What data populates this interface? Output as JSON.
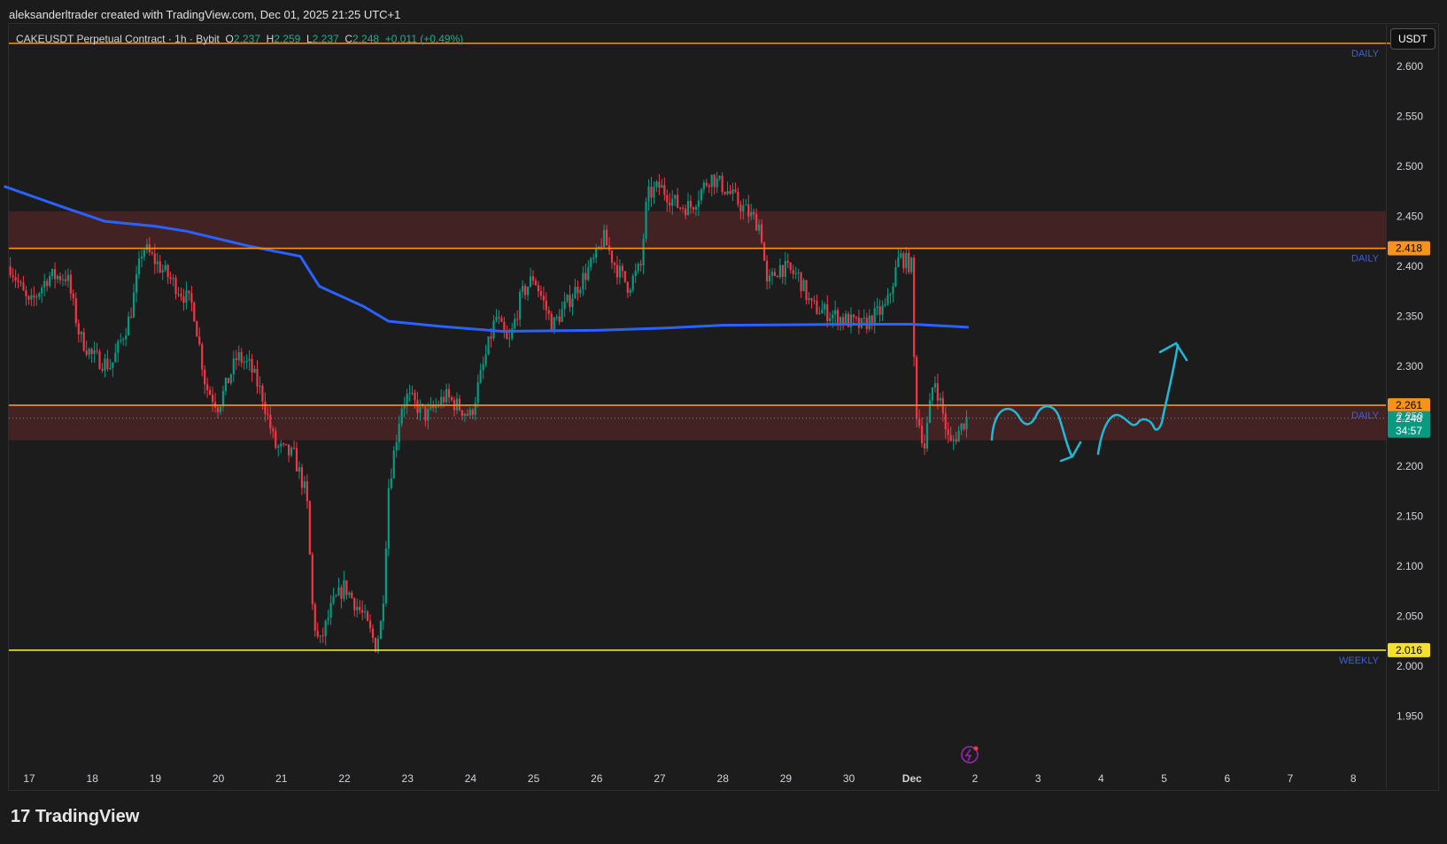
{
  "credit": "aleksanderltrader created with TradingView.com, Dec 01, 2025 21:25 UTC+1",
  "legend": {
    "symbol": "CAKEUSDT Perpetual Contract · 1h · Bybit",
    "o_label": "O",
    "o": "2.237",
    "h_label": "H",
    "h": "2.259",
    "l_label": "L",
    "l": "2.237",
    "c_label": "C",
    "c": "2.248",
    "change": "+0.011 (+0.49%)"
  },
  "currency_button": "USDT",
  "logo": "TradingView",
  "colors": {
    "up": "#089981",
    "down": "#f23645",
    "level": "#f7931a",
    "weekly": "#f5e02a",
    "ema": "#2962ff",
    "zone": "#4a2326",
    "drawing": "#1ebad6"
  },
  "chart_data": {
    "type": "candlestick",
    "ylim": [
      1.9,
      2.63
    ],
    "y_ticks": [
      "2.600",
      "2.550",
      "2.500",
      "2.450",
      "2.400",
      "2.350",
      "2.300",
      "2.250",
      "2.200",
      "2.150",
      "2.100",
      "2.050",
      "2.000",
      "1.950"
    ],
    "x_ticks": [
      "17",
      "18",
      "19",
      "20",
      "21",
      "22",
      "23",
      "24",
      "25",
      "26",
      "27",
      "28",
      "29",
      "30",
      "Dec",
      "2",
      "3",
      "4",
      "5",
      "6",
      "7",
      "8"
    ],
    "price_path": [
      [
        16.7,
        2.4
      ],
      [
        17.0,
        2.36
      ],
      [
        17.3,
        2.39
      ],
      [
        17.6,
        2.39
      ],
      [
        17.8,
        2.33
      ],
      [
        18.0,
        2.31
      ],
      [
        18.3,
        2.3
      ],
      [
        18.6,
        2.35
      ],
      [
        18.8,
        2.42
      ],
      [
        19.2,
        2.39
      ],
      [
        19.6,
        2.36
      ],
      [
        19.8,
        2.28
      ],
      [
        20.0,
        2.26
      ],
      [
        20.3,
        2.31
      ],
      [
        20.5,
        2.3
      ],
      [
        20.7,
        2.27
      ],
      [
        20.9,
        2.22
      ],
      [
        21.2,
        2.21
      ],
      [
        21.4,
        2.17
      ],
      [
        21.5,
        2.05
      ],
      [
        21.6,
        2.02
      ],
      [
        21.8,
        2.06
      ],
      [
        22.0,
        2.08
      ],
      [
        22.3,
        2.05
      ],
      [
        22.5,
        2.02
      ],
      [
        22.6,
        2.05
      ],
      [
        22.7,
        2.18
      ],
      [
        22.9,
        2.26
      ],
      [
        23.0,
        2.27
      ],
      [
        23.3,
        2.25
      ],
      [
        23.6,
        2.27
      ],
      [
        24.0,
        2.25
      ],
      [
        24.2,
        2.3
      ],
      [
        24.4,
        2.35
      ],
      [
        24.6,
        2.32
      ],
      [
        24.8,
        2.37
      ],
      [
        25.0,
        2.39
      ],
      [
        25.3,
        2.34
      ],
      [
        25.5,
        2.36
      ],
      [
        25.7,
        2.38
      ],
      [
        26.0,
        2.41
      ],
      [
        26.1,
        2.43
      ],
      [
        26.3,
        2.4
      ],
      [
        26.5,
        2.38
      ],
      [
        26.7,
        2.4
      ],
      [
        26.8,
        2.47
      ],
      [
        27.0,
        2.48
      ],
      [
        27.3,
        2.46
      ],
      [
        27.5,
        2.46
      ],
      [
        27.8,
        2.49
      ],
      [
        28.0,
        2.48
      ],
      [
        28.3,
        2.46
      ],
      [
        28.6,
        2.44
      ],
      [
        28.7,
        2.38
      ],
      [
        28.9,
        2.4
      ],
      [
        29.2,
        2.39
      ],
      [
        29.4,
        2.36
      ],
      [
        29.8,
        2.35
      ],
      [
        30.2,
        2.34
      ],
      [
        30.6,
        2.36
      ],
      [
        30.8,
        2.41
      ],
      [
        31.0,
        2.4
      ],
      [
        31.05,
        2.26
      ],
      [
        31.2,
        2.22
      ],
      [
        31.35,
        2.29
      ],
      [
        31.5,
        2.25
      ],
      [
        31.6,
        2.22
      ],
      [
        31.86,
        2.248
      ]
    ],
    "ema": [
      [
        16.6,
        2.48
      ],
      [
        17.5,
        2.46
      ],
      [
        18.2,
        2.445
      ],
      [
        19.0,
        2.44
      ],
      [
        19.5,
        2.435
      ],
      [
        20.5,
        2.42
      ],
      [
        21.3,
        2.41
      ],
      [
        21.6,
        2.38
      ],
      [
        22.3,
        2.36
      ],
      [
        22.7,
        2.345
      ],
      [
        23.5,
        2.34
      ],
      [
        24.5,
        2.335
      ],
      [
        26,
        2.336
      ],
      [
        27,
        2.338
      ],
      [
        28,
        2.341
      ],
      [
        30,
        2.342
      ],
      [
        31,
        2.342
      ],
      [
        31.9,
        2.339
      ]
    ],
    "zones": [
      [
        2.418,
        2.455
      ],
      [
        2.226,
        2.261
      ]
    ],
    "levels": [
      {
        "price": 2.623,
        "label": "DAILY",
        "tag": ""
      },
      {
        "price": 2.418,
        "label": "DAILY",
        "tag": "2.418"
      },
      {
        "price": 2.261,
        "label": "DAILY",
        "tag": "2.261"
      },
      {
        "price": 2.016,
        "label": "WEEKLY",
        "tag": "2.016"
      }
    ],
    "last_price": "2.248",
    "countdown": "34:57"
  }
}
